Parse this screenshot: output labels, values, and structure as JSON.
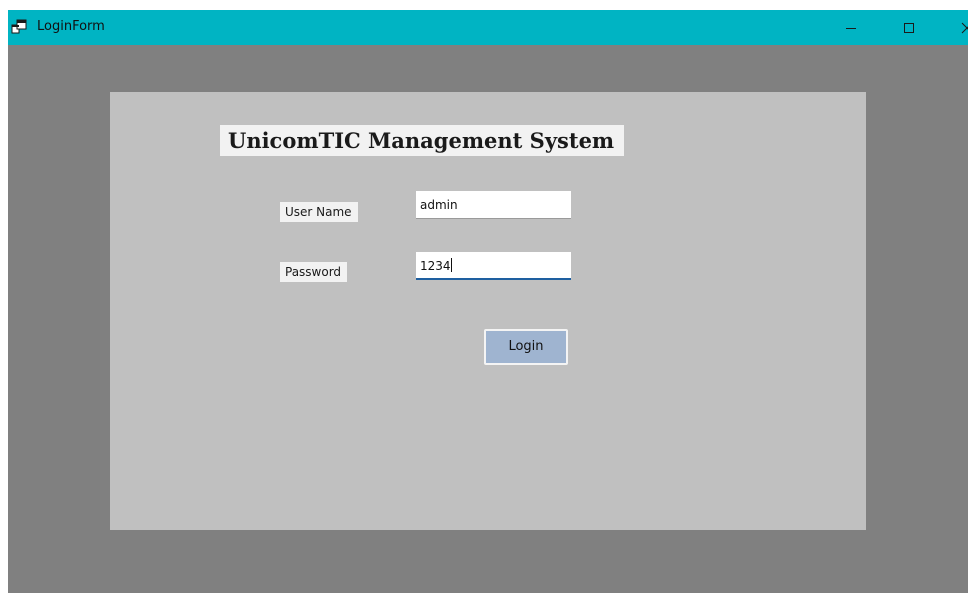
{
  "window": {
    "title": "LoginForm",
    "app_icon": "winforms-app-icon",
    "controls": {
      "minimize_icon": "minimize-icon",
      "maximize_icon": "maximize-icon",
      "close_icon": "close-icon"
    },
    "titlebar_color": "#00b4c3"
  },
  "form": {
    "heading": "UnicomTIC Management System",
    "username_label": "User Name",
    "username_value": "admin",
    "password_label": "Password",
    "password_value": "1234",
    "login_label": "Login"
  },
  "colors": {
    "window_background": "#808080",
    "panel_background": "#c0c0c0",
    "button_background": "#9fb4d0",
    "focus_underline": "#1e5fa0"
  }
}
